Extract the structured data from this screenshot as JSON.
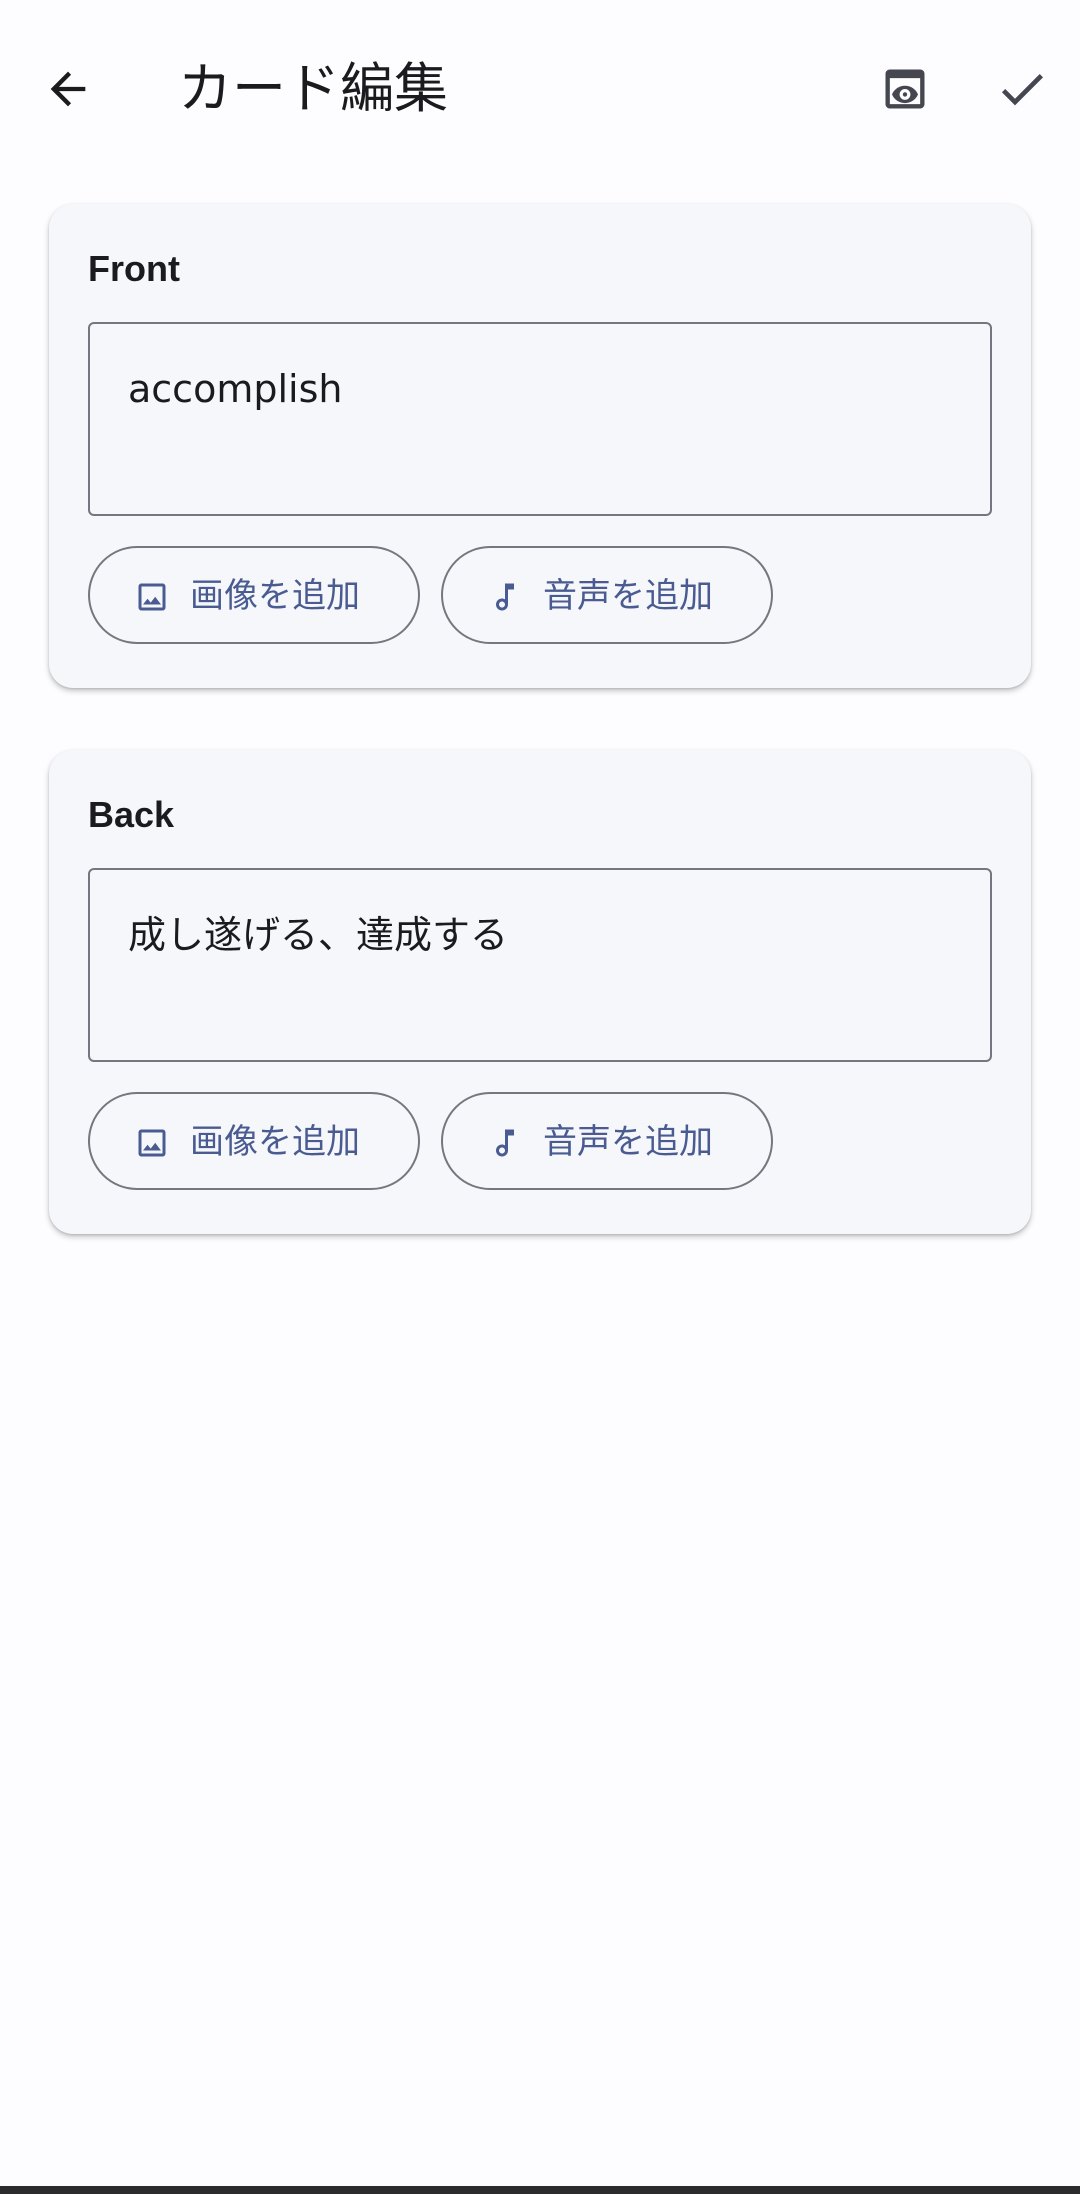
{
  "header": {
    "title": "カード編集",
    "back_icon": "arrow-back-icon",
    "preview_icon": "preview-eye-icon",
    "save_icon": "check-icon"
  },
  "cards": [
    {
      "label": "Front",
      "value": "accomplish",
      "add_image_label": "画像を追加",
      "add_audio_label": "音声を追加"
    },
    {
      "label": "Back",
      "value": "成し遂げる、達成する",
      "add_image_label": "画像を追加",
      "add_audio_label": "音声を追加"
    }
  ],
  "colors": {
    "background": "#fdfcff",
    "card": "#f6f7fa",
    "outline": "#74777f",
    "accent": "#4a5b92",
    "text": "#1b1b1f"
  }
}
